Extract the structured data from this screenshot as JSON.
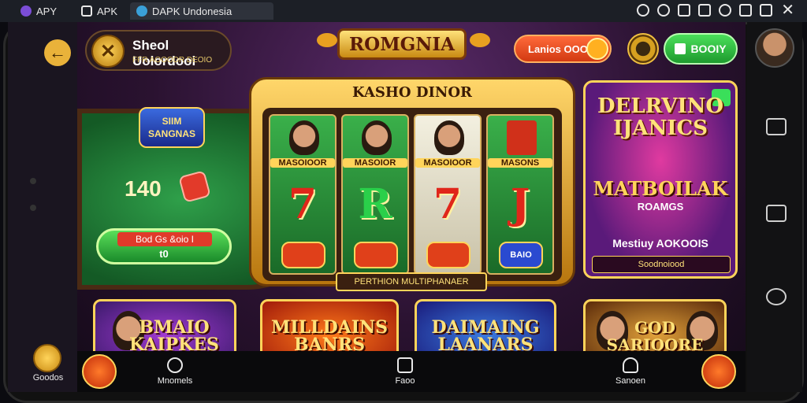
{
  "browser": {
    "tabs": [
      {
        "label": "APY"
      },
      {
        "label": "APK"
      },
      {
        "label": "DAPK Undonesia"
      }
    ]
  },
  "side": {
    "coin_label": "Goodos"
  },
  "header": {
    "wallet_title": "Sheol Uolordooi",
    "wallet_sub": "FFR AOOODR DEOIO",
    "logo": "ROMGNIA",
    "red_button": "Lanios OOO",
    "green_button": "BOOIY"
  },
  "felt": {
    "badge": "SIIM SANGNAS",
    "amount": "140",
    "button_label": "Bod Gs &oio I",
    "button_sub": "t0"
  },
  "slot": {
    "title": "KASHO DINOR",
    "caption": "PERTHION MULTIPHANAER",
    "reels": [
      {
        "name": "MASOIOOR",
        "symbol": "7",
        "chip": ""
      },
      {
        "name": "MASOIOR",
        "symbol": "R",
        "chip": ""
      },
      {
        "name": "MASOIOOR",
        "symbol": "7",
        "chip": ""
      },
      {
        "name": "MASONS",
        "symbol": "J",
        "chip": "BAIO"
      }
    ]
  },
  "promo": {
    "headline": "DELRVINO IJANICS",
    "subheadline": "MATBOILAK",
    "subline": "ROAMGS",
    "line": "Mestiuy AOKOOIS",
    "bar": "Soodnoiood"
  },
  "cards": [
    {
      "title": "BMAIO KAIPKES"
    },
    {
      "title": "MILLDAINS BANRS"
    },
    {
      "title": "DAIMAING LAANARS"
    },
    {
      "title": "GOD SARIOORE"
    }
  ],
  "bottom_nav": {
    "items": [
      {
        "label": "Mnomels"
      },
      {
        "label": "Faoo"
      },
      {
        "label": "Sanoen"
      }
    ]
  }
}
